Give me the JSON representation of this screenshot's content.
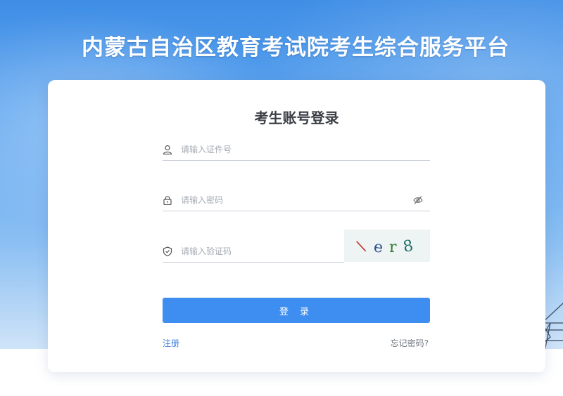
{
  "platform_title": "内蒙古自治区教育考试院考生综合服务平台",
  "login": {
    "title": "考生账号登录",
    "id_placeholder": "请输入证件号",
    "password_placeholder": "请输入密码",
    "captcha_placeholder": "请输入验证码",
    "captcha_text": "\\er8",
    "submit_label": "登 录",
    "register_label": "注册",
    "forgot_label": "忘记密码?"
  },
  "colors": {
    "accent": "#3d8ef0",
    "link": "#3d7fdc",
    "hero_top": "#3f8ee6"
  },
  "icons": [
    "user-icon",
    "lock-icon",
    "shield-icon",
    "eye-off-icon",
    "transmission-tower-icon"
  ]
}
